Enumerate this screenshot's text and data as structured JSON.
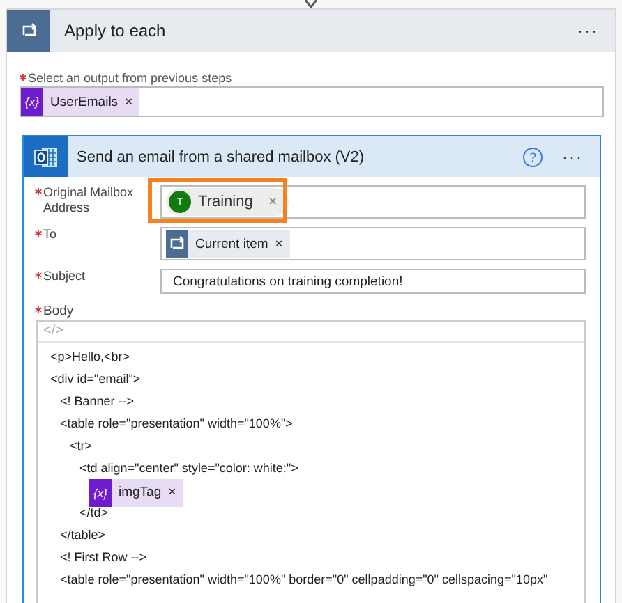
{
  "loop": {
    "title": "Apply to each",
    "menu": "···",
    "field_label": "Select an output from previous steps",
    "required": true,
    "tokens": [
      {
        "kind": "variable",
        "icon": "{x}",
        "label": "UserEmails",
        "remove": "×"
      }
    ]
  },
  "action": {
    "title": "Send an email from a shared mailbox (V2)",
    "help": "?",
    "menu": "···",
    "fields": [
      {
        "label": "Original Mailbox Address",
        "required": true,
        "highlighted": true,
        "kind": "tokens",
        "tokens": [
          {
            "kind": "person",
            "initial": "T",
            "label": "Training",
            "remove": "×"
          }
        ]
      },
      {
        "label": "To",
        "required": true,
        "highlighted": false,
        "kind": "tokens",
        "tokens": [
          {
            "kind": "loop",
            "label": "Current item",
            "remove": "×"
          }
        ]
      },
      {
        "label": "Subject",
        "required": true,
        "highlighted": false,
        "kind": "text",
        "value": "Congratulations on training completion!"
      }
    ],
    "body": {
      "label": "Body",
      "required": true,
      "mode_toggle": "</>",
      "lines": [
        {
          "kind": "code",
          "text": "<p>Hello,<br>"
        },
        {
          "kind": "code",
          "text": "<div id=\"email\">",
          "children": [
            {
              "kind": "code",
              "text": "<! Banner -->"
            },
            {
              "kind": "code",
              "text": "<table role=\"presentation\" width=\"100%\">",
              "children": [
                {
                  "kind": "code",
                  "text": "<tr>",
                  "children": [
                    {
                      "kind": "code",
                      "text": "<td  align=\"center\" style=\"color: white;\">",
                      "children": [
                        {
                          "kind": "token",
                          "icon": "{x}",
                          "label": "imgTag",
                          "remove": "×"
                        }
                      ]
                    },
                    {
                      "kind": "code",
                      "text": "</td>"
                    }
                  ]
                }
              ]
            },
            {
              "kind": "code",
              "text": "</table>"
            },
            {
              "kind": "code",
              "text": "<! First Row -->"
            },
            {
              "kind": "code",
              "text": "<table role=\"presentation\" width=\"100%\" border=\"0\" cellpadding=\"0\" cellspacing=\"10px\""
            }
          ]
        }
      ]
    }
  }
}
